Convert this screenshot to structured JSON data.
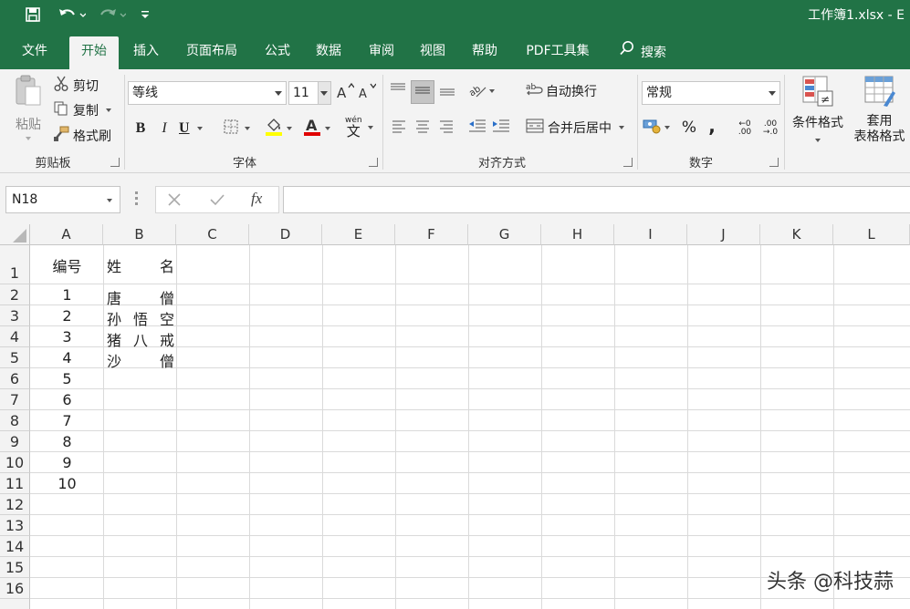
{
  "title_bar": {
    "title": "工作簿1.xlsx  -  E",
    "qat": [
      "save-icon",
      "undo-icon",
      "redo-icon",
      "customize-icon"
    ]
  },
  "tabs": [
    {
      "label": "文件"
    },
    {
      "label": "开始",
      "active": true
    },
    {
      "label": "插入"
    },
    {
      "label": "页面布局"
    },
    {
      "label": "公式"
    },
    {
      "label": "数据"
    },
    {
      "label": "审阅"
    },
    {
      "label": "视图"
    },
    {
      "label": "帮助"
    },
    {
      "label": "PDF工具集"
    },
    {
      "label": "搜索"
    }
  ],
  "ribbon": {
    "clipboard": {
      "label": "剪贴板",
      "paste": "粘贴",
      "cut": "剪切",
      "copy": "复制",
      "format_painter": "格式刷"
    },
    "font": {
      "label": "字体",
      "font_name": "等线",
      "font_size": "11",
      "bold": "B",
      "italic": "I",
      "underline": "U",
      "wen_small": "wén",
      "wen_big": "文"
    },
    "alignment": {
      "label": "对齐方式",
      "wrap_text": "自动换行",
      "merge_center": "合并后居中",
      "orientation_text": "ab"
    },
    "number": {
      "label": "数字",
      "format": "常规",
      "percent": "%",
      "comma": ",",
      "dec_up_top": "←0",
      "dec_up_bot": ".00",
      "dec_down_top": ".00",
      "dec_down_bot": "→.0"
    },
    "styles": {
      "conditional": "条件格式",
      "table_fmt_1": "套用",
      "table_fmt_2": "表格格式"
    }
  },
  "formula_bar": {
    "name_box": "N18",
    "fx": "fx",
    "content": ""
  },
  "columns": [
    "A",
    "B",
    "C",
    "D",
    "E",
    "F",
    "G",
    "H",
    "I",
    "J",
    "K",
    "L"
  ],
  "rows": [
    "1",
    "2",
    "3",
    "4",
    "5",
    "6",
    "7",
    "8",
    "9",
    "10",
    "11",
    "12",
    "13",
    "14",
    "15",
    "16"
  ],
  "cells": {
    "A": [
      "编号",
      "1",
      "2",
      "3",
      "4",
      "5",
      "6",
      "7",
      "8",
      "9",
      "10"
    ],
    "B": [
      [
        "姓",
        "名"
      ],
      [
        "唐",
        "",
        "僧"
      ],
      [
        "孙",
        "悟",
        "空"
      ],
      [
        "猪",
        "八",
        "戒"
      ],
      [
        "沙",
        "",
        "僧"
      ]
    ]
  },
  "watermark": "头条 @科技蒜",
  "colors": {
    "excel_green": "#217346",
    "ribbon_bg": "#f3f3f3",
    "grid_line": "#dadada"
  }
}
